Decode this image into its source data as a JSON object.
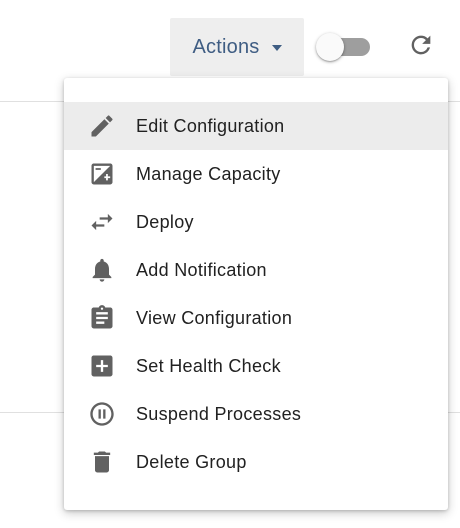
{
  "toolbar": {
    "actions_label": "Actions",
    "toggle_on": false
  },
  "menu": {
    "items": [
      {
        "label": "Edit Configuration",
        "icon": "pencil-icon",
        "active": true
      },
      {
        "label": "Manage Capacity",
        "icon": "capacity-icon"
      },
      {
        "label": "Deploy",
        "icon": "swap-arrows-icon"
      },
      {
        "label": "Add Notification",
        "icon": "bell-icon"
      },
      {
        "label": "View Configuration",
        "icon": "clipboard-icon"
      },
      {
        "label": "Set Health Check",
        "icon": "plus-box-icon"
      },
      {
        "label": "Suspend Processes",
        "icon": "pause-circle-icon"
      },
      {
        "label": "Delete Group",
        "icon": "trash-icon"
      }
    ]
  },
  "colors": {
    "accent": "#3f5d83",
    "icon": "#616161",
    "active_row": "#ececec"
  }
}
